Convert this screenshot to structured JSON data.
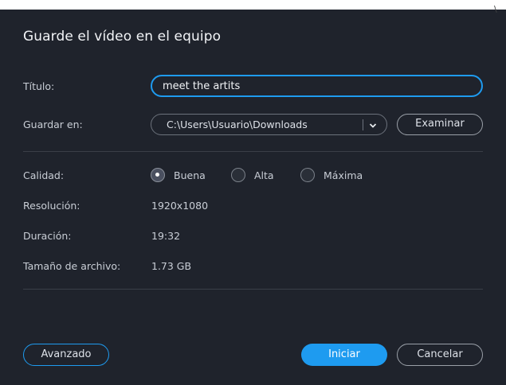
{
  "dialog": {
    "title": "Guarde el vídeo en el equipo",
    "corner_mark": "\\"
  },
  "form": {
    "title_label": "Título:",
    "title_value": "meet the artits",
    "save_label": "Guardar en:",
    "save_path": "C:\\Users\\Usuario\\Downloads",
    "browse_label": "Examinar"
  },
  "info": {
    "quality_label": "Calidad:",
    "quality_options": [
      {
        "label": "Buena",
        "selected": true
      },
      {
        "label": "Alta",
        "selected": false
      },
      {
        "label": "Máxima",
        "selected": false
      }
    ],
    "resolution_label": "Resolución:",
    "resolution_value": "1920x1080",
    "duration_label": "Duración:",
    "duration_value": "19:32",
    "size_label": "Tamaño de archivo:",
    "size_value": "1.73 GB"
  },
  "footer": {
    "advanced_label": "Avanzado",
    "start_label": "Iniciar",
    "cancel_label": "Cancelar"
  },
  "colors": {
    "background": "#1f232c",
    "accent": "#1e9bf0",
    "text": "#dde1e8"
  },
  "icons": {
    "dropdown": "chevron-down-icon"
  }
}
